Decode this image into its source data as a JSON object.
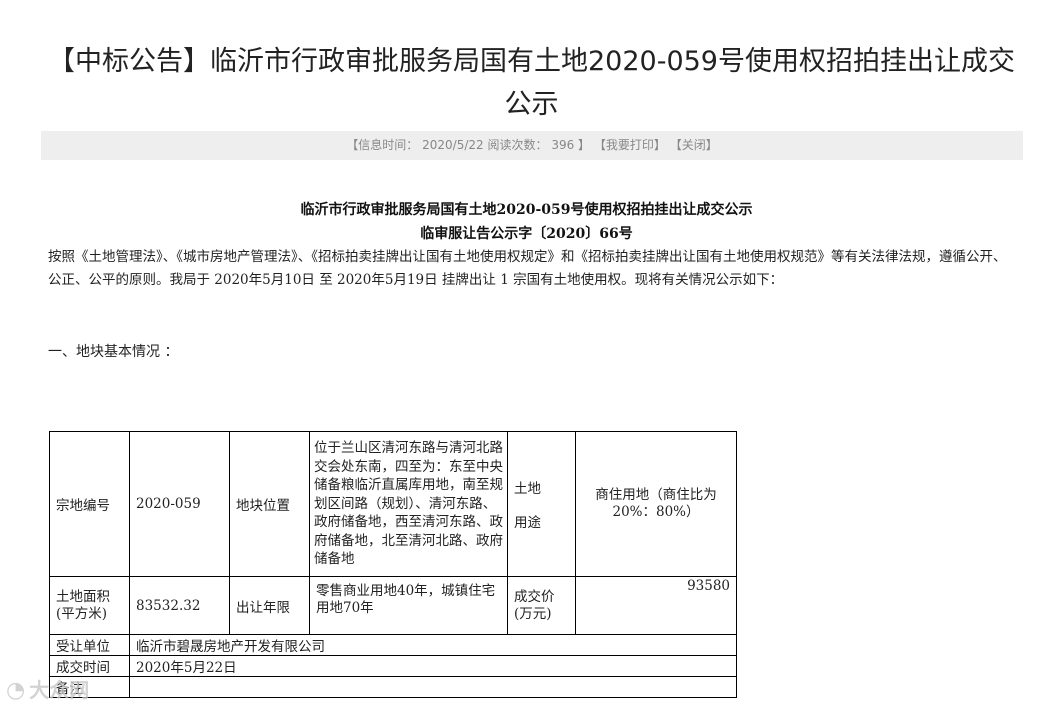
{
  "header": {
    "title": "【中标公告】临沂市行政审批服务局国有土地2020-059号使用权招拍挂出让成交公示"
  },
  "infobar": {
    "open": "【",
    "time_label": "信息时间：",
    "time_value": "2020/5/22",
    "reads_label": "阅读次数：",
    "reads_value": "396",
    "close_bracket": "】",
    "print": "【我要打印】",
    "close": "【关闭】"
  },
  "document": {
    "title": "临沂市行政审批服务局国有土地2020-059号使用权招拍挂出让成交公示",
    "doc_number": "临审服让告公示字〔2020〕66号",
    "paragraph": "按照《土地管理法》、《城市房地产管理法》、《招标拍卖挂牌出让国有土地使用权规定》和《招标拍卖挂牌出让国有土地使用权规范》等有关法律法规，遵循公开、公正、公平的原则。我局于 2020年5月10日 至 2020年5月19日 挂牌出让 1 宗国有土地使用权。现将有关情况公示如下：",
    "section_heading": "一、地块基本情况 ："
  },
  "table": {
    "parcel_no_label": "宗地编号",
    "parcel_no_value": "2020-059",
    "location_label": "地块位置",
    "location_value": "位于兰山区清河东路与清河北路交会处东南，四至为：东至中央储备粮临沂直属库用地，南至规划区间路（规划）、清河东路、政府储备地，西至清河东路、政府储备地，北至清河北路、政府储备地",
    "land_use_label_1": "土地",
    "land_use_label_2": "用途",
    "land_use_value": "商住用地（商住比为20%：80%）",
    "area_label": "土地面积(平方米)",
    "area_value": "83532.32",
    "term_label": "出让年限",
    "term_value": "零售商业用地40年，城镇住宅用地70年",
    "price_label": "成交价(万元)",
    "price_value": "93580",
    "winner_label": "受让单位",
    "winner_value": "临沂市碧晟房地产开发有限公司",
    "deal_time_label": "成交时间",
    "deal_time_value": "2020年5月22日",
    "remark_label": "备注"
  },
  "watermark": {
    "text": "大众网"
  }
}
